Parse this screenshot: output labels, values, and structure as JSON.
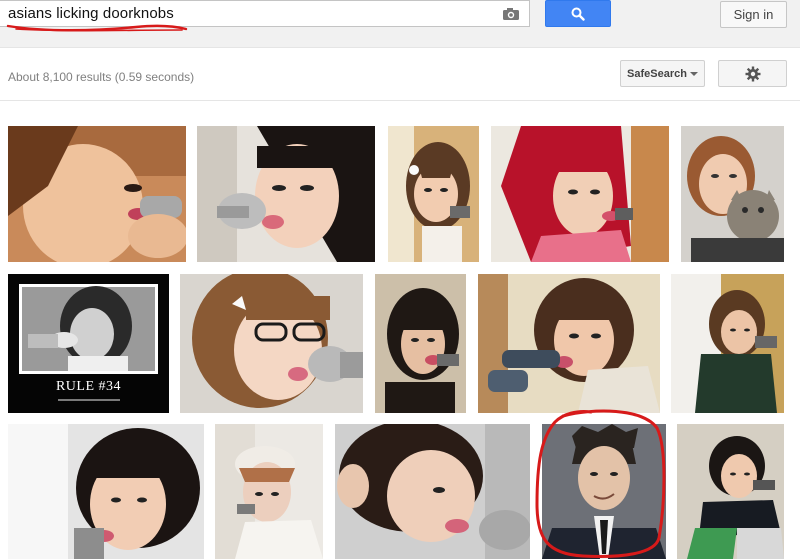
{
  "search": {
    "query": "asians licking doorknobs",
    "camera_icon": "camera-icon",
    "search_icon": "search-icon"
  },
  "header": {
    "signin_label": "Sign in"
  },
  "toolbar": {
    "results_stats": "About 8,100 results (0.59 seconds)",
    "safesearch_label": "SafeSearch",
    "settings_icon": "gear-icon"
  },
  "results": {
    "poster_title": "RULE #34"
  },
  "colors": {
    "search_blue": "#4285f4",
    "annotation_red": "#d71a1a",
    "topbar_bg": "#f1f1f1"
  }
}
